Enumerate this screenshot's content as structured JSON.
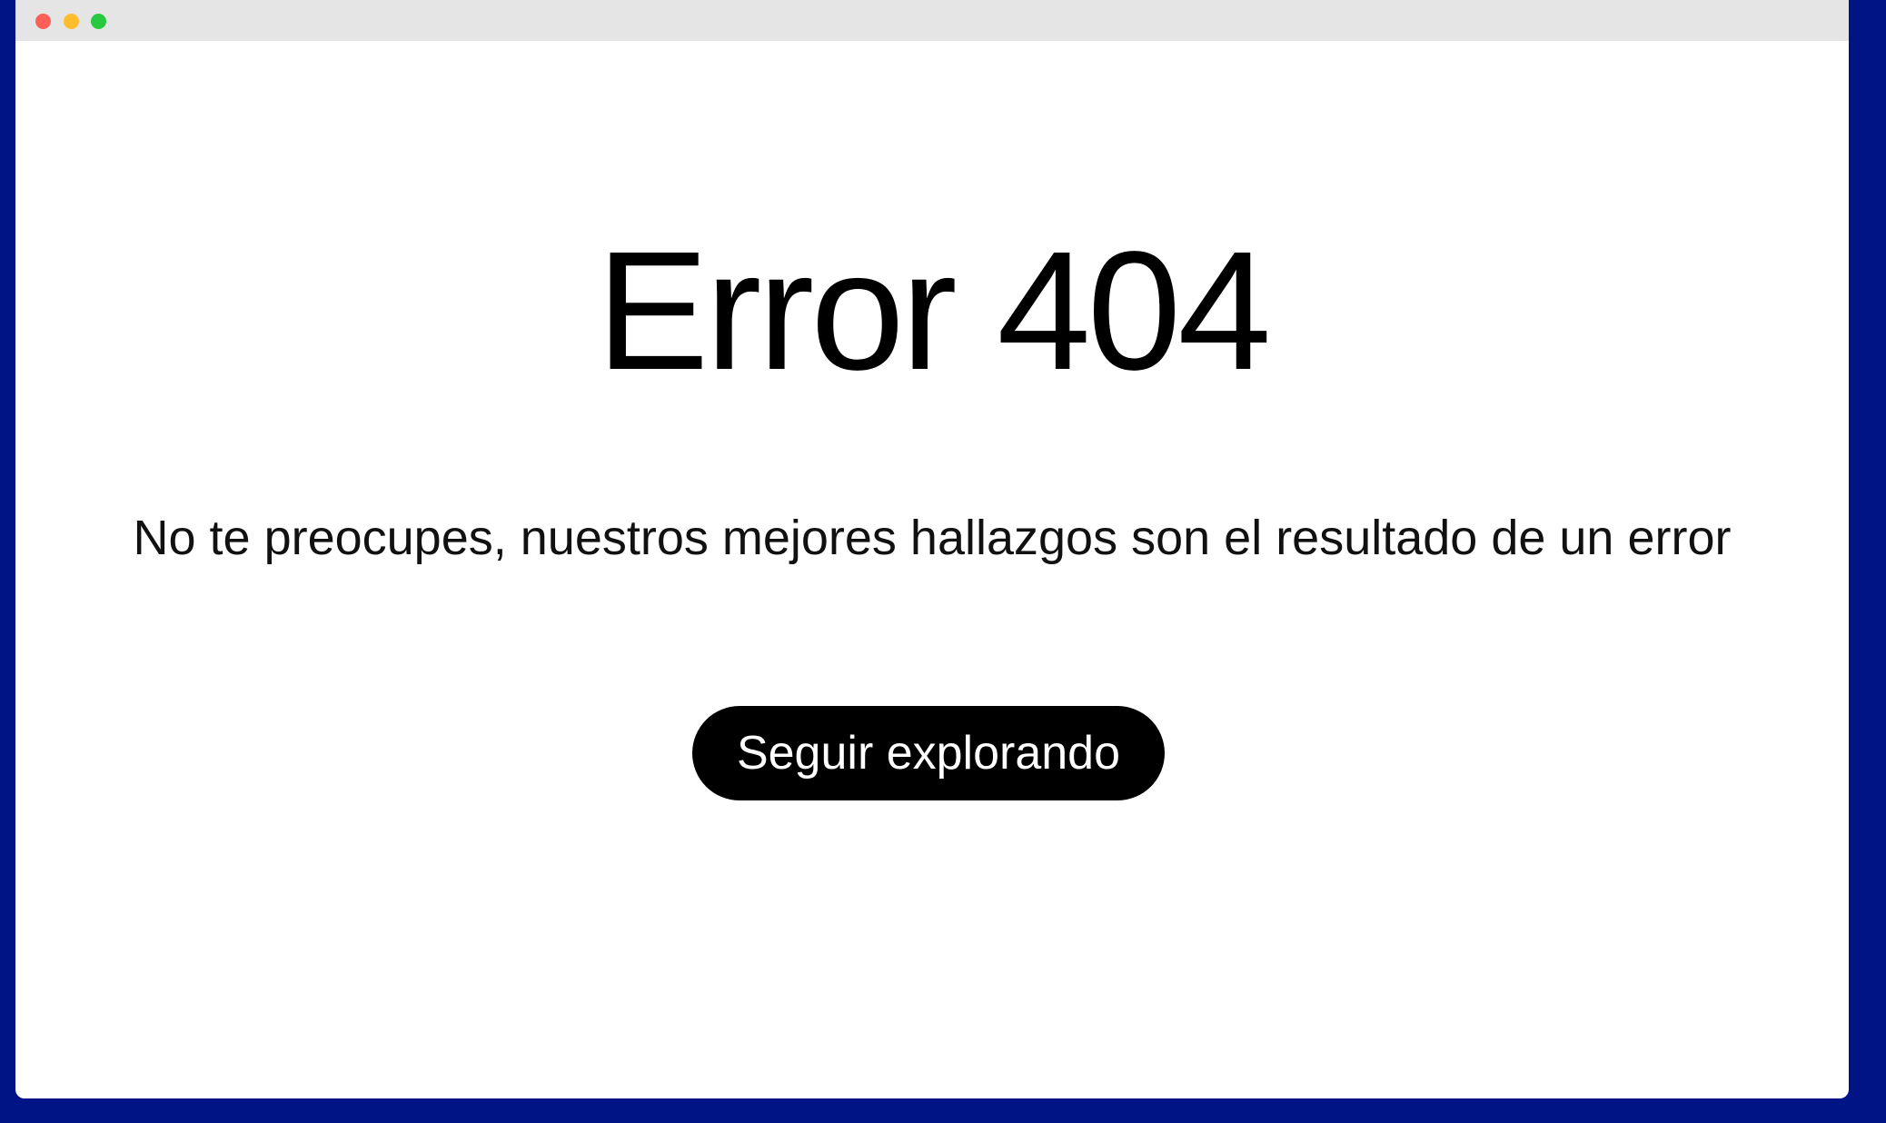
{
  "window": {
    "controls": {
      "close_color": "#ff5f57",
      "minimize_color": "#ffbd2e",
      "maximize_color": "#28c840"
    }
  },
  "page": {
    "title": "Error 404",
    "message": "No te preocupes, nuestros mejores hallazgos son el resultado de un error",
    "button_label": "Seguir explorando"
  },
  "colors": {
    "background": "#001486",
    "button": "#000000",
    "button_text": "#ffffff"
  }
}
